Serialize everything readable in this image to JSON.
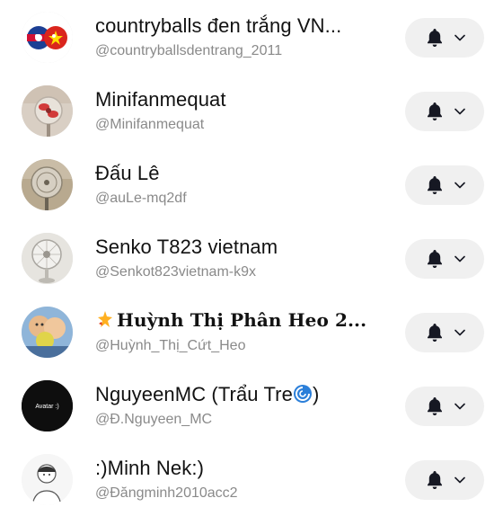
{
  "accounts": [
    {
      "name": "countryballs đen trắng VN...",
      "handle": "@countryballsdentrang_2011",
      "avatar_icon": "flag-avatar"
    },
    {
      "name": "Minifanmequat",
      "handle": "@Minifanmequat",
      "avatar_icon": "fan-avatar"
    },
    {
      "name": "Đấu Lê",
      "handle": "@auLe-mq2df",
      "avatar_icon": "fan-avatar"
    },
    {
      "name": "Senko T823 vietnam",
      "handle": "@Senkot823vietnam-k9x",
      "avatar_icon": "fan-avatar"
    },
    {
      "name": "Huỳnh Thị Phân Heo 2...",
      "handle": "@Huỳnh_Thị_Cứt_Heo",
      "avatar_icon": "photo-avatar",
      "name_prefix_icon": "sparkle-emoji"
    },
    {
      "name": "NguyeenMC (Trẩu Tre",
      "name_suffix": ")",
      "handle": "@Đ.Nguyeen_MC",
      "avatar_icon": "avatar-dark",
      "avatar_text": "Avatar :)",
      "name_inline_icon": "cyclone-emoji"
    },
    {
      "name": ":)Minh Nek:)",
      "handle": "@Đăngminh2010acc2",
      "avatar_icon": "sketch-avatar"
    }
  ],
  "colors": {
    "name_text": "#121212",
    "handle_text": "#8a8a8a",
    "button_bg": "#f0f0f0",
    "icon": "#161823"
  }
}
